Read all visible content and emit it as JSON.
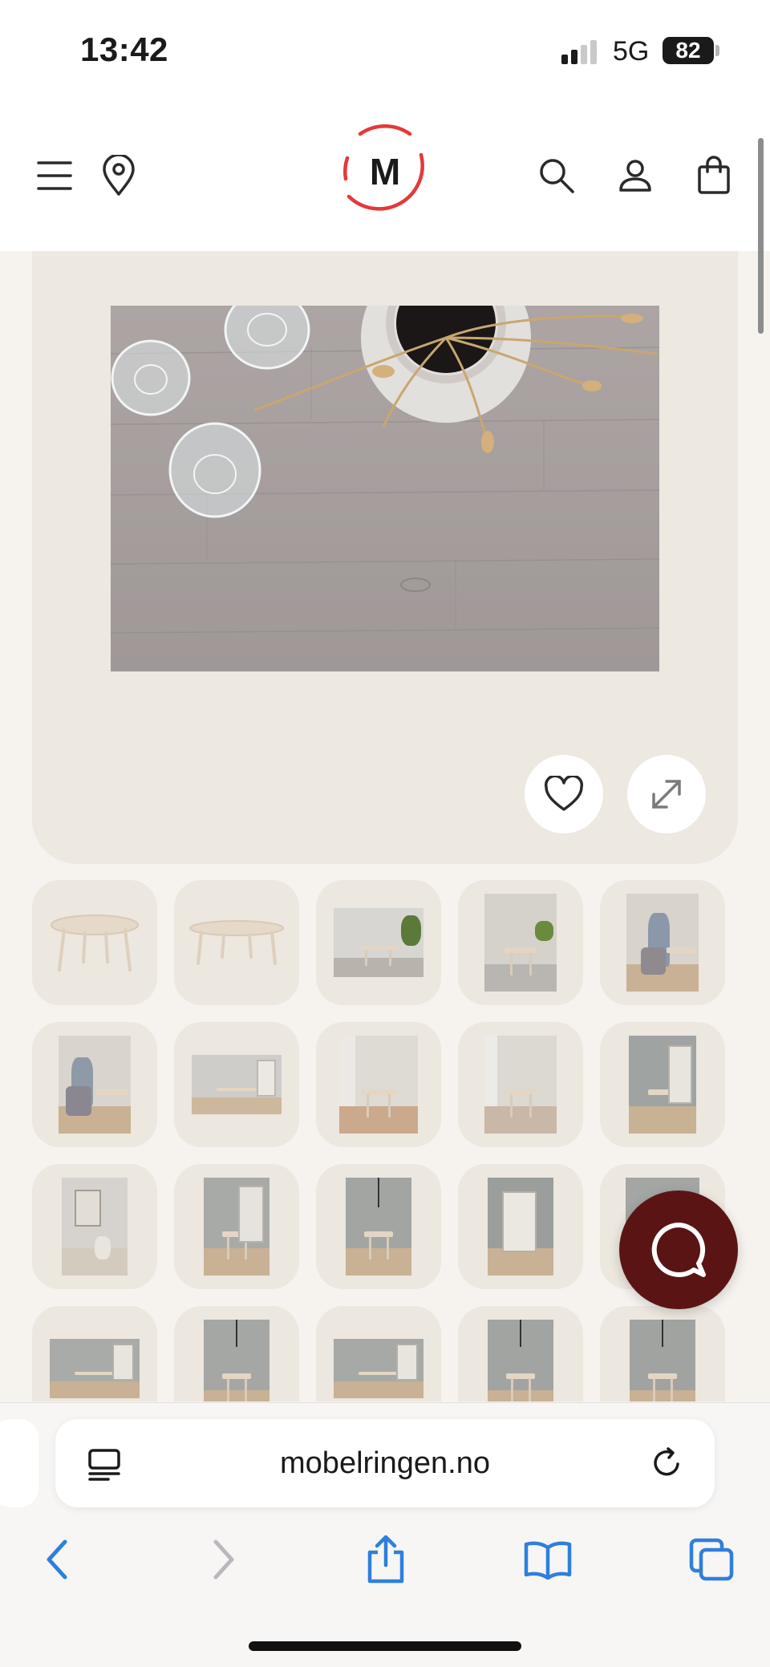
{
  "status_bar": {
    "time": "13:42",
    "network": "5G",
    "battery": "82"
  },
  "header": {
    "logo_letter": "M",
    "brand_color": "#e3393a",
    "icons": [
      "menu-icon",
      "location-pin-icon",
      "search-icon",
      "user-icon",
      "shopping-bag-icon"
    ]
  },
  "product_gallery": {
    "main_image": "oak table top with glasses and vase",
    "actions": [
      "heart-icon",
      "expand-icon"
    ],
    "thumbnails": [
      "round table white background",
      "extended table white background",
      "dining room with plant",
      "dining room with rug",
      "woman seated at table",
      "woman seated in chair",
      "dining set with cabinet",
      "dining set by window",
      "dining set by window with curtain",
      "dining set with lamp",
      "wall art and vase",
      "dining set with cabinet and lamp",
      "table with pendant lamp",
      "glass cabinet",
      "dining set partially covered",
      "dining set with sideboard",
      "table with pendant lamp",
      "dining set with sideboard",
      "table with chairs and lamp",
      "table with pendant lamp"
    ]
  },
  "chat_button": {
    "color": "#5b1414"
  },
  "browser": {
    "url": "mobelringen.no",
    "nav_icons": [
      "back-icon",
      "forward-icon",
      "share-icon",
      "bookmarks-icon",
      "tabs-icon"
    ],
    "accent": "#2f7fdc"
  }
}
